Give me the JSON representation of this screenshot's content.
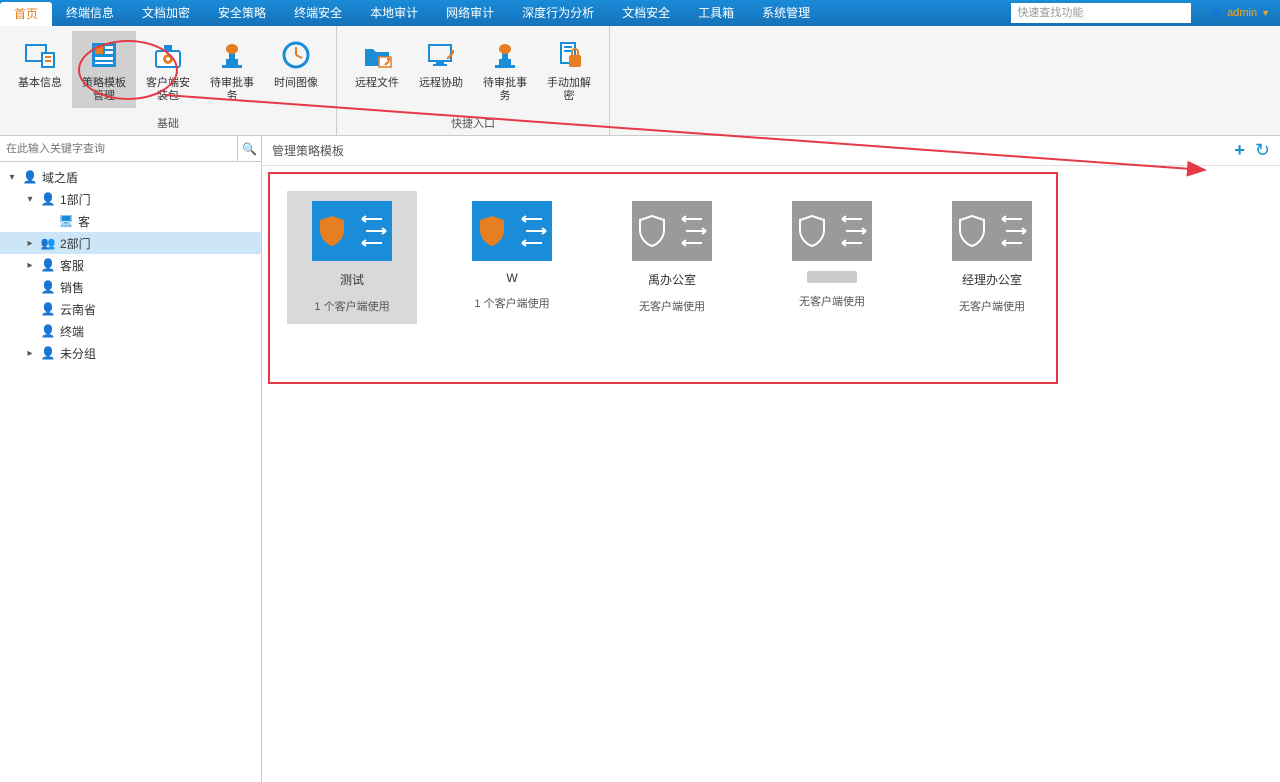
{
  "topMenu": {
    "tabs": [
      "首页",
      "终端信息",
      "文档加密",
      "安全策略",
      "终端安全",
      "本地审计",
      "网络审计",
      "深度行为分析",
      "文档安全",
      "工具箱",
      "系统管理"
    ],
    "activeIndex": 0,
    "searchPlaceholder": "快速查找功能",
    "userName": "admin"
  },
  "ribbon": {
    "groups": [
      {
        "label": "基础",
        "items": [
          {
            "label": "基本信息",
            "icon": "info"
          },
          {
            "label": "策略模板管理",
            "icon": "template",
            "highlighted": true
          },
          {
            "label": "客户端安装包",
            "icon": "package"
          },
          {
            "label": "待审批事务",
            "icon": "stamp"
          },
          {
            "label": "时间图像",
            "icon": "clock"
          }
        ]
      },
      {
        "label": "快捷入口",
        "items": [
          {
            "label": "远程文件",
            "icon": "folder"
          },
          {
            "label": "远程协助",
            "icon": "monitor"
          },
          {
            "label": "待审批事务",
            "icon": "stamp2"
          },
          {
            "label": "手动加解密",
            "icon": "lock"
          }
        ]
      }
    ]
  },
  "sidebar": {
    "searchPlaceholder": "在此输入关键字查询",
    "tree": [
      {
        "level": 0,
        "toggle": "▾",
        "icon": "user",
        "label": "域之盾",
        "selected": false
      },
      {
        "level": 1,
        "toggle": "▾",
        "icon": "user",
        "label": "1部门",
        "selected": false
      },
      {
        "level": 2,
        "toggle": "",
        "icon": "pc",
        "label": "客",
        "selected": false
      },
      {
        "level": 1,
        "toggle": "▸",
        "icon": "users",
        "label": "2部门",
        "selected": true
      },
      {
        "level": 1,
        "toggle": "▸",
        "icon": "user",
        "label": "客服",
        "selected": false
      },
      {
        "level": 1,
        "toggle": "",
        "icon": "user",
        "label": "销售",
        "selected": false
      },
      {
        "level": 1,
        "toggle": "",
        "icon": "user",
        "label": "云南省",
        "selected": false
      },
      {
        "level": 1,
        "toggle": "",
        "icon": "user",
        "label": "终端",
        "selected": false
      },
      {
        "level": 1,
        "toggle": "▸",
        "icon": "user",
        "label": "未分组",
        "selected": false
      }
    ]
  },
  "content": {
    "title": "管理策略模板",
    "cards": [
      {
        "name": "测试",
        "sub": "1 个客户端使用",
        "style": "blue",
        "selected": true
      },
      {
        "name": "W",
        "sub": "1 个客户端使用",
        "style": "blue",
        "selected": false
      },
      {
        "name": "禹办公室",
        "sub": "无客户端使用",
        "style": "gray",
        "selected": false
      },
      {
        "name": "",
        "sub": "无客户端使用",
        "style": "gray",
        "selected": false,
        "pill": true
      },
      {
        "name": "经理办公室",
        "sub": "无客户端使用",
        "style": "gray",
        "selected": false
      }
    ]
  }
}
